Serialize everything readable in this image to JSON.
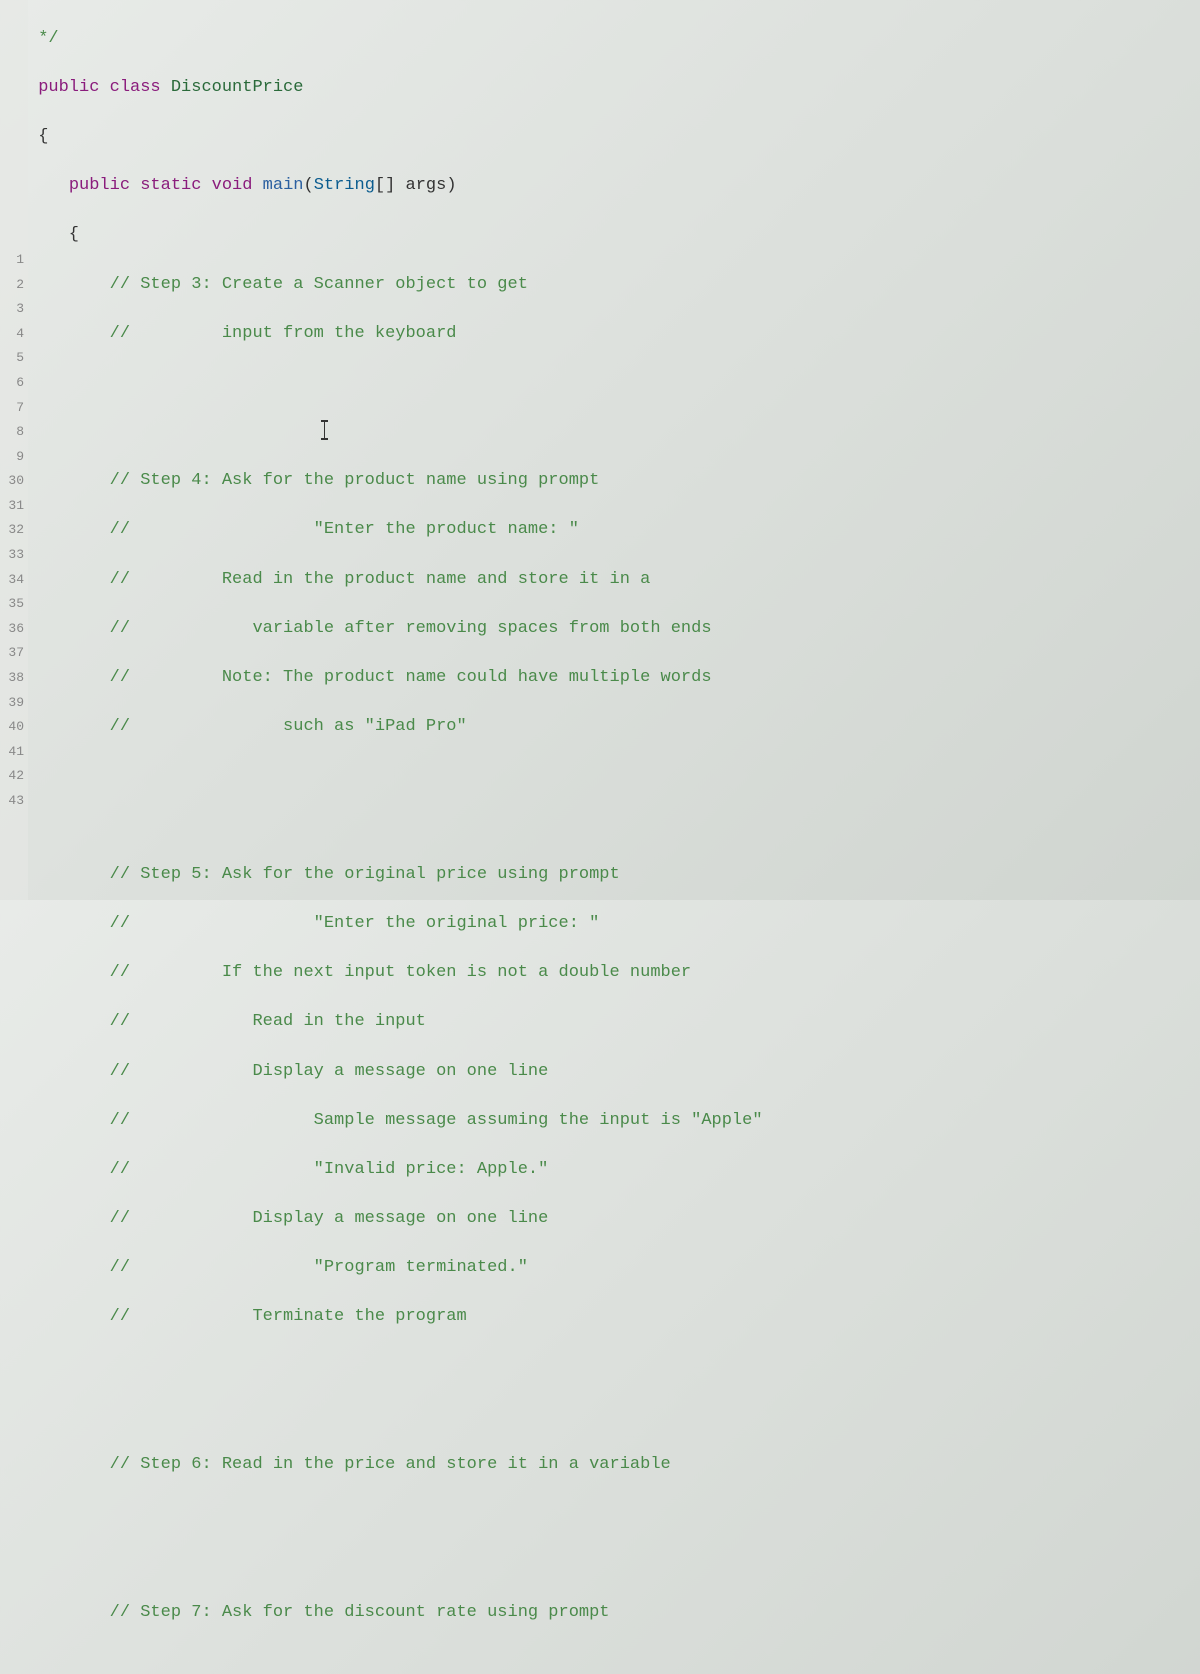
{
  "gutter": [
    "",
    "",
    "",
    "",
    "",
    "",
    "",
    "",
    "",
    "",
    "1",
    "2",
    "3",
    "4",
    "5",
    "6",
    "7",
    "8",
    "9",
    "30",
    "31",
    "32",
    "33",
    "34",
    "35",
    "36",
    "37",
    "38",
    "39",
    "40",
    "41",
    "42",
    "43"
  ],
  "l0": {
    "a": " */"
  },
  "l1": {
    "a": " ",
    "b": "public",
    "c": " ",
    "d": "class",
    "e": " ",
    "f": "DiscountPrice"
  },
  "l2": {
    "a": " {"
  },
  "l3": {
    "a": "    ",
    "b": "public",
    "c": " ",
    "d": "static",
    "e": " ",
    "f": "void",
    "g": " ",
    "h": "main",
    "i": "(",
    "j": "String",
    "k": "[] ",
    "l": "args",
    "m": ")"
  },
  "l4": {
    "a": "    {"
  },
  "l5": {
    "a": "        ",
    "b": "// Step 3: Create a Scanner object to get"
  },
  "l6": {
    "a": "        ",
    "b": "//         input from the keyboard"
  },
  "l7": {
    "a": ""
  },
  "l8": {
    "a": "                             "
  },
  "l9": {
    "a": "        ",
    "b": "// Step 4: Ask for the product name using prompt"
  },
  "l10": {
    "a": "        ",
    "b": "//                  \"Enter the product name: \""
  },
  "l11": {
    "a": "        ",
    "b": "//         Read in the product name and store it in a"
  },
  "l12": {
    "a": "        ",
    "b": "//            variable after removing spaces from both ends"
  },
  "l13": {
    "a": "        ",
    "b": "//         Note: The product name could have multiple words"
  },
  "l14": {
    "a": "        ",
    "b": "//               such as \"iPad Pro\""
  },
  "l15": {
    "a": ""
  },
  "l16": {
    "a": ""
  },
  "l17": {
    "a": "        ",
    "b": "// Step 5: Ask for the original price using prompt"
  },
  "l18": {
    "a": "        ",
    "b": "//                  \"Enter the original price: \""
  },
  "l19": {
    "a": "        ",
    "b": "//         If the next input token is not a double number"
  },
  "l20": {
    "a": "        ",
    "b": "//            Read in the input"
  },
  "l21": {
    "a": "        ",
    "b": "//            Display a message on one line"
  },
  "l22": {
    "a": "        ",
    "b": "//                  Sample message assuming the input is \"Apple\""
  },
  "l23": {
    "a": "        ",
    "b": "//                  \"Invalid price: Apple.\""
  },
  "l24": {
    "a": "        ",
    "b": "//            Display a message on one line"
  },
  "l25": {
    "a": "        ",
    "b": "//                  \"Program terminated.\""
  },
  "l26": {
    "a": "        ",
    "b": "//            Terminate the program"
  },
  "l27": {
    "a": ""
  },
  "l28": {
    "a": ""
  },
  "l29": {
    "a": "        ",
    "b": "// Step 6: Read in the price and store it in a variable"
  },
  "l30": {
    "a": ""
  },
  "l31": {
    "a": ""
  },
  "l32": {
    "a": "        ",
    "b": "// Step 7: Ask for the discount rate using prompt"
  }
}
